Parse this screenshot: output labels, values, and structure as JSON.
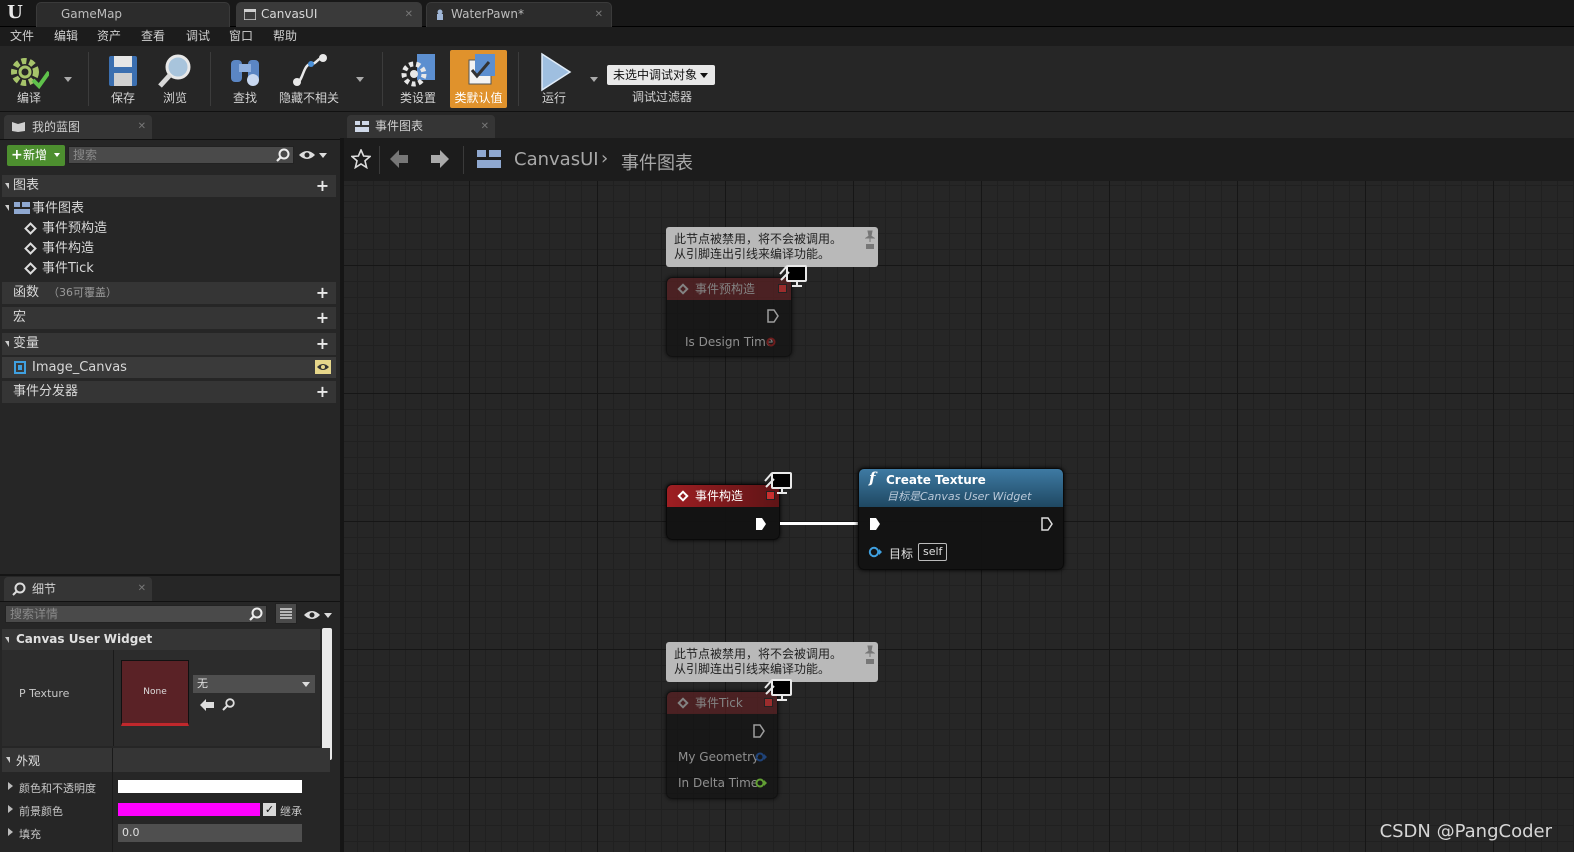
{
  "window": {
    "tabs": [
      {
        "label": "GameMap"
      },
      {
        "label": "CanvasUI"
      },
      {
        "label": "WaterPawn*"
      }
    ]
  },
  "menu": [
    "文件",
    "编辑",
    "资产",
    "查看",
    "调试",
    "窗口",
    "帮助"
  ],
  "toolbar": {
    "compile": "编译",
    "save": "保存",
    "browse": "浏览",
    "find": "查找",
    "hide_unrelated": "隐藏不相关",
    "class_settings": "类设置",
    "class_defaults": "类默认值",
    "run": "运行",
    "debug_object": "未选中调试对象",
    "debug_filter": "调试过滤器"
  },
  "my_blueprint": {
    "tab": "我的蓝图",
    "new_button": "新增",
    "search_placeholder": "搜索",
    "graphs_header": "图表",
    "event_graph": "事件图表",
    "events": [
      "事件预构造",
      "事件构造",
      "事件Tick"
    ],
    "functions_header": "函数",
    "functions_override": "（36可覆盖）",
    "macros_header": "宏",
    "variables_header": "变量",
    "variable": "Image_Canvas",
    "dispatchers_header": "事件分发器"
  },
  "details": {
    "tab": "细节",
    "search_placeholder": "搜索详情",
    "category": "Canvas User Widget",
    "p_texture_label": "P Texture",
    "texture_thumb": "None",
    "texture_value": "无",
    "appearance": "外观",
    "color_opacity": "颜色和不透明度",
    "foreground_color": "前景颜色",
    "inherit": "继承",
    "padding": "填充",
    "padding_value": "0.0"
  },
  "graph": {
    "tab": "事件图表",
    "breadcrumb_root": "CanvasUI",
    "breadcrumb_current": "事件图表",
    "disabled_comment_line1": "此节点被禁用，将不会被调用。",
    "disabled_comment_line2": "从引脚连出引线来编译功能。",
    "node_preconstruct": "事件预构造",
    "is_design_time": "Is Design Time",
    "node_construct": "事件构造",
    "node_tick": "事件Tick",
    "my_geometry": "My Geometry",
    "in_delta_time": "In Delta Time",
    "create_texture_title": "Create Texture",
    "create_texture_subtitle": "目标是Canvas User Widget",
    "target_label": "目标",
    "target_value": "self"
  },
  "colors": {
    "accent_orange": "#e0922c",
    "event_red": "#8b1c1c",
    "function_blue": "#2b5f82",
    "foreground_magenta": "#ff00ff"
  },
  "watermark": "CSDN @PangCoder"
}
